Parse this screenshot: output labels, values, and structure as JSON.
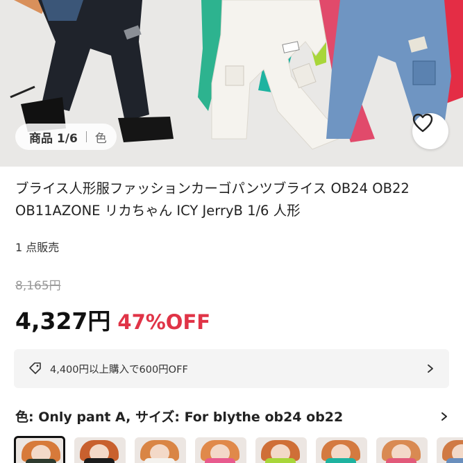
{
  "gallery": {
    "page_indicator": "商品 1/6",
    "variant_tab": "色",
    "favorite_icon": "heart-outline-icon"
  },
  "product": {
    "title": "ブライス人形服ファッションカーゴパンツブライス OB24 OB22 OB11AZONE リカちゃん ICY JerryB 1/6 人形",
    "sold_count": "1 点販売",
    "original_price": "8,165円",
    "price": "4,327円",
    "discount": "47%OFF"
  },
  "coupon": {
    "icon": "ticket-icon",
    "text": "4,400円以上購入で600円OFF"
  },
  "variant": {
    "text": "色: Only pant A, サイズ: For blythe ob24 ob22"
  },
  "thumbnails": [
    {
      "selected": true,
      "hair": "#d77a3a",
      "cloth": "#2e3b2f"
    },
    {
      "selected": false,
      "hair": "#c8602e",
      "cloth": "#1c1c1c"
    },
    {
      "selected": false,
      "hair": "#d98545",
      "cloth": "#f4f2ee"
    },
    {
      "selected": false,
      "hair": "#e0894a",
      "cloth": "#e85b8e"
    },
    {
      "selected": false,
      "hair": "#cf6f37",
      "cloth": "#a8d63a"
    },
    {
      "selected": false,
      "hair": "#d47a40",
      "cloth": "#1eb3a0"
    },
    {
      "selected": false,
      "hair": "#d98a52",
      "cloth": "#e25a7a"
    },
    {
      "selected": false,
      "hair": "#d07a44",
      "cloth": "#6a8fbd"
    }
  ],
  "colors": {
    "discount": "#e03447",
    "accent_text": "#222222"
  }
}
